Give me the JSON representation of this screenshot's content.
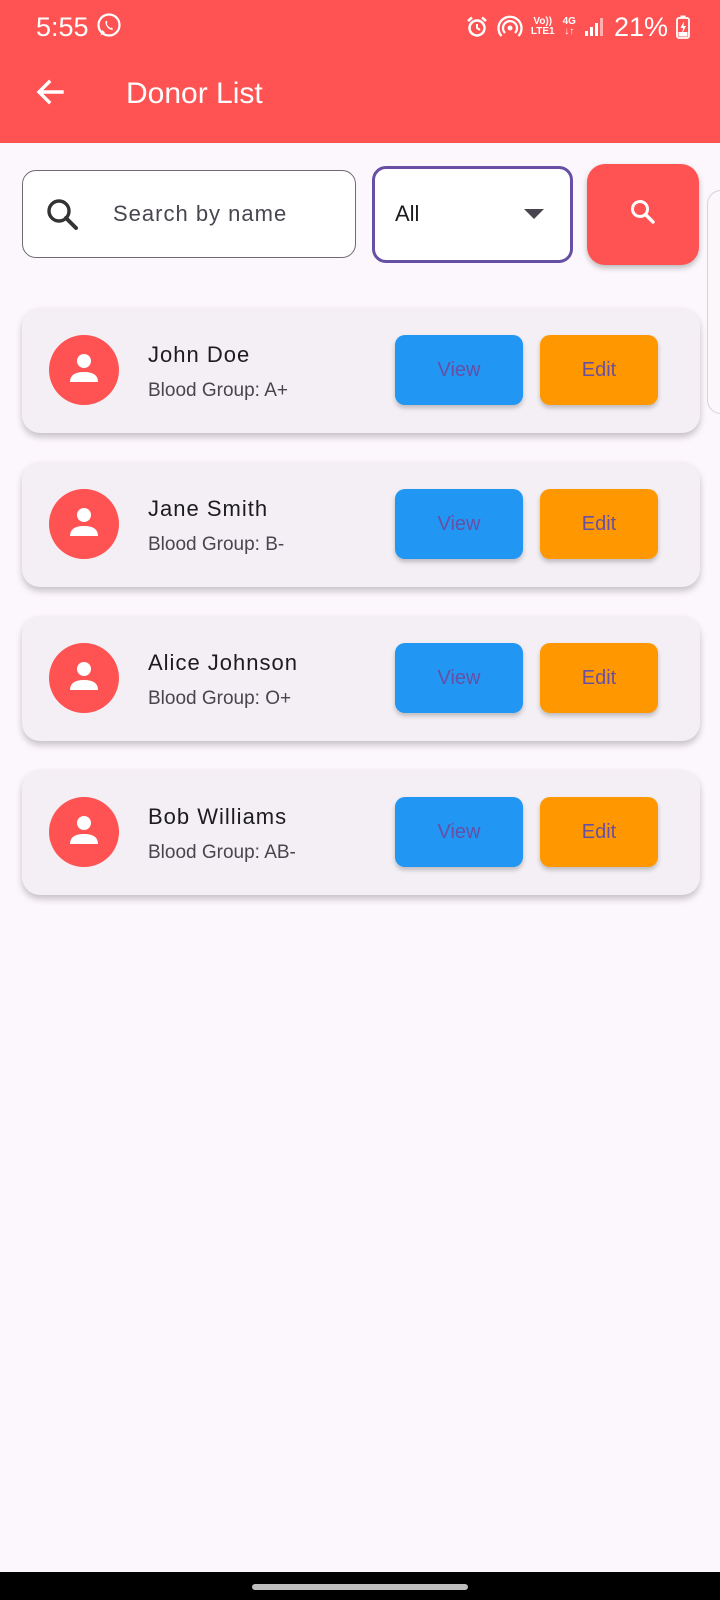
{
  "status_bar": {
    "time": "5:55",
    "network_top": "Vo))",
    "network_bottom": "LTE1",
    "network_type": "4G",
    "battery": "21%"
  },
  "app_bar": {
    "title": "Donor List",
    "back_icon": "arrow-back-icon",
    "background": "#FF5252"
  },
  "search": {
    "placeholder": "Search by name",
    "value": "",
    "icon": "search-icon"
  },
  "filter": {
    "selected": "All"
  },
  "search_button": {
    "icon": "search-icon"
  },
  "donors": [
    {
      "name": "John Doe",
      "blood": "Blood Group: A+",
      "view_label": "View",
      "edit_label": "Edit"
    },
    {
      "name": "Jane Smith",
      "blood": "Blood Group: B-",
      "view_label": "View",
      "edit_label": "Edit"
    },
    {
      "name": "Alice Johnson",
      "blood": "Blood Group: O+",
      "view_label": "View",
      "edit_label": "Edit"
    },
    {
      "name": "Bob Williams",
      "blood": "Blood Group: AB-",
      "view_label": "View",
      "edit_label": "Edit"
    }
  ],
  "colors": {
    "accent": "#FF5252",
    "view_button": "#2196F3",
    "edit_button": "#FF9800",
    "button_text": "#6750A4",
    "card": "#F3EFF4"
  }
}
